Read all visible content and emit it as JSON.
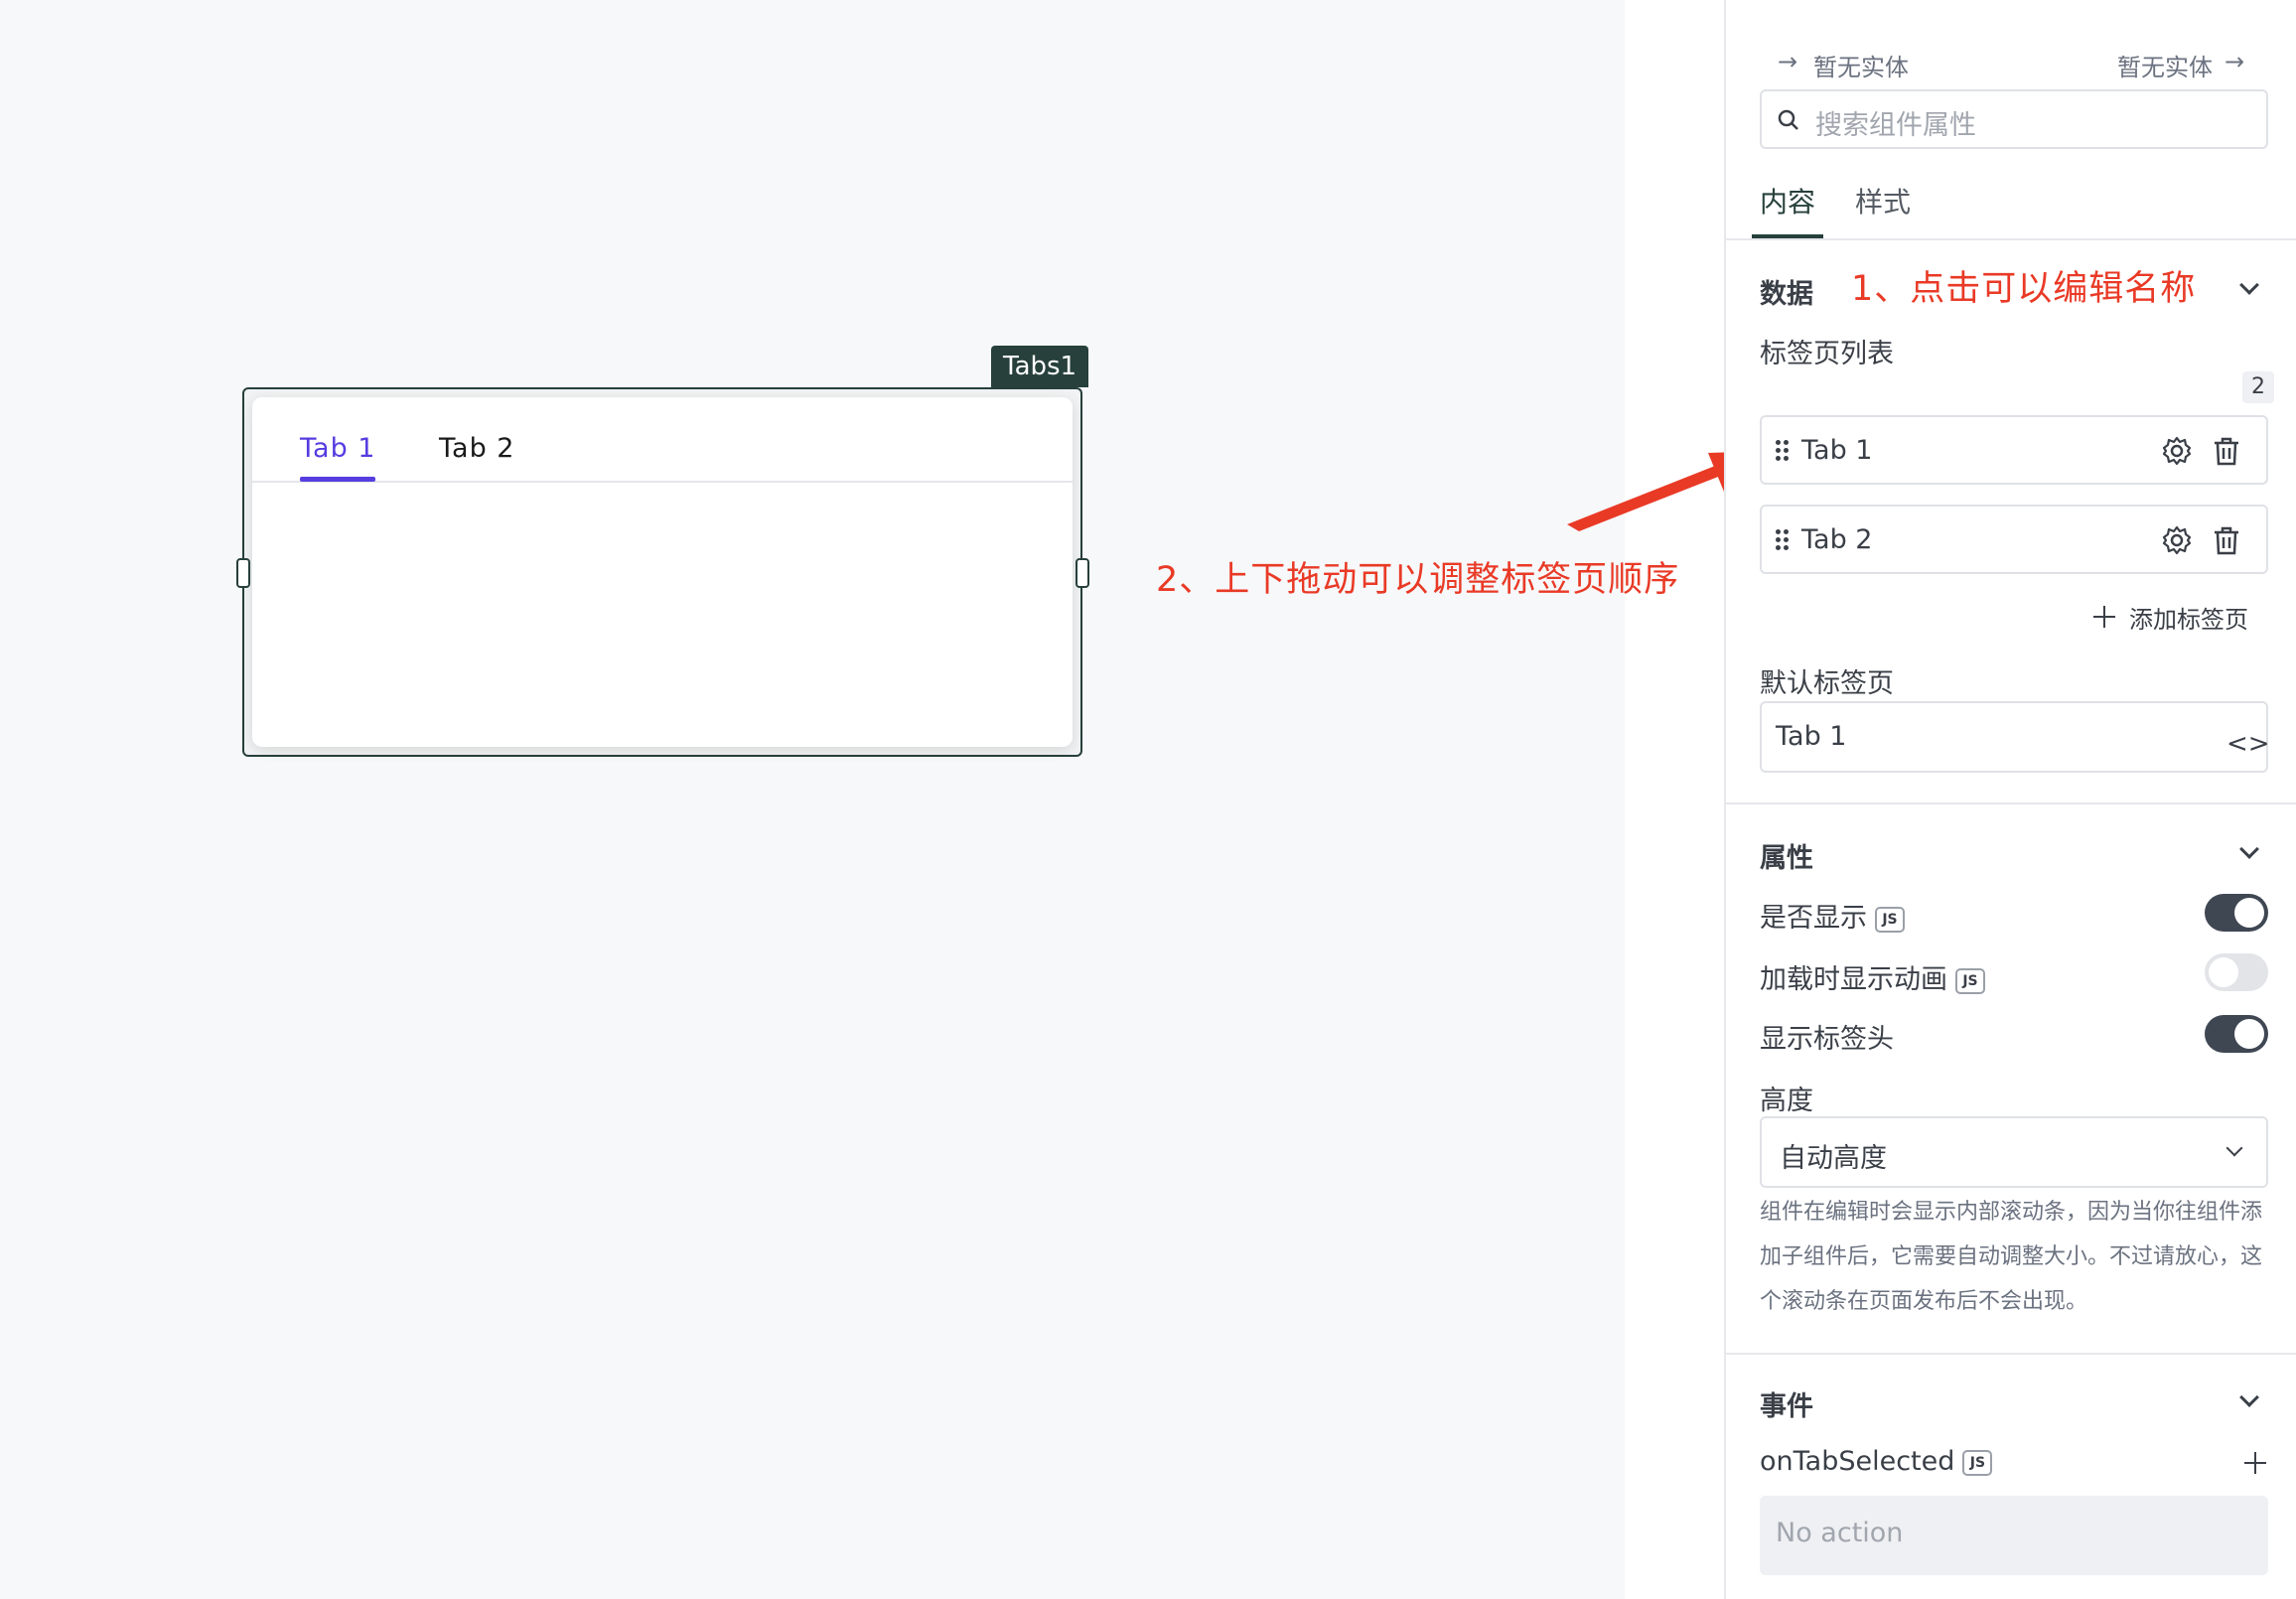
{
  "widget": {
    "name": "Tabs1",
    "tabs": [
      "Tab 1",
      "Tab 2"
    ]
  },
  "annotations": {
    "click_edit": "1、点击可以编辑名称",
    "drag_reorder": "2、上下拖动可以调整标签页顺序"
  },
  "panel": {
    "entity_left": "暂无实体",
    "entity_right": "暂无实体",
    "search_placeholder": "搜索组件属性",
    "tabs": [
      "内容",
      "样式"
    ],
    "data_section": {
      "title": "数据",
      "list_label": "标签页列表",
      "count": "2",
      "items": [
        "Tab 1",
        "Tab 2"
      ],
      "add_label": "添加标签页",
      "default_label": "默认标签页",
      "default_value": "Tab 1"
    },
    "props_section": {
      "title": "属性",
      "visible_label": "是否显示",
      "animate_label": "加载时显示动画",
      "header_label": "显示标签头",
      "js_badge": "JS",
      "visible_on": true,
      "animate_on": false,
      "header_on": true,
      "height_label": "高度",
      "height_value": "自动高度",
      "help_text": "组件在编辑时会显示内部滚动条，因为当你往组件添加子组件后，它需要自动调整大小。不过请放心，这个滚动条在页面发布后不会出现。"
    },
    "events_section": {
      "title": "事件",
      "event_name": "onTabSelected",
      "no_action": "No action"
    }
  },
  "colors": {
    "accent": "#553de0",
    "frame": "#27403b",
    "annotation": "#e93a26",
    "toggle_on": "#3f4753"
  }
}
